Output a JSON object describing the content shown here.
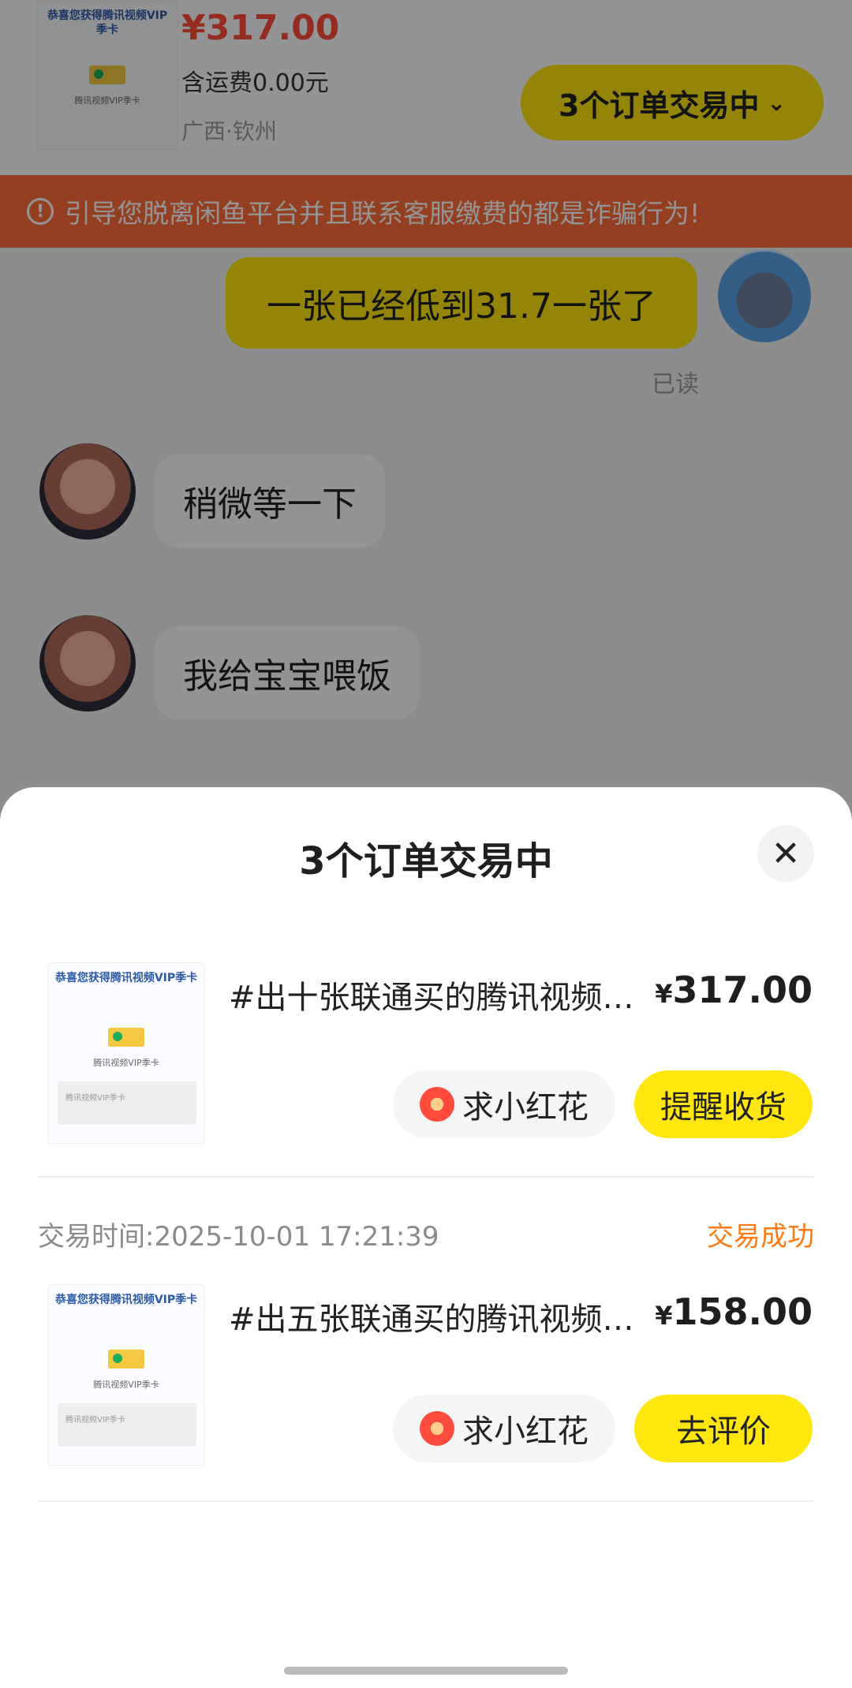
{
  "header": {
    "price": "¥317.00",
    "shipping": "含运费0.00元",
    "location": "广西·钦州",
    "orders_button": "3个订单交易中",
    "orders_chevron": "⌄"
  },
  "thumbnail": {
    "title": "恭喜您获得腾讯视频VIP季卡",
    "subtitle": "腾讯视频VIP季卡",
    "card_text": "腾讯视频VIP季卡"
  },
  "warning": {
    "icon": "!",
    "text": "引导您脱离闲鱼平台并且联系客服缴费的都是诈骗行为!"
  },
  "chat": {
    "messages": [
      {
        "from": "me",
        "text": "一张已经低到31.7一张了",
        "status": "已读"
      },
      {
        "from": "other",
        "text": "稍微等一下"
      },
      {
        "from": "other",
        "text": "我给宝宝喂饭"
      }
    ]
  },
  "sheet": {
    "title": "3个订单交易中",
    "close": "✕",
    "orders": [
      {
        "title": "#出十张联通买的腾讯视频…",
        "currency": "¥",
        "price": "317.00",
        "secondary_action": "求小红花",
        "primary_action": "提醒收货"
      },
      {
        "time": "交易时间:2025-10-01 17:21:39",
        "status": "交易成功",
        "title": "#出五张联通买的腾讯视频…",
        "currency": "¥",
        "price": "158.00",
        "secondary_action": "求小红花",
        "primary_action": "去评价"
      }
    ]
  },
  "colors": {
    "accent_yellow": "#ffe60f",
    "warning_orange": "#ff6b3c",
    "price_red": "#ff4c3b",
    "status_orange": "#ff7a12"
  }
}
